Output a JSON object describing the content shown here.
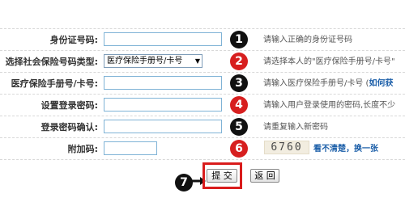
{
  "form": {
    "rows": [
      {
        "label": "身份证号码:",
        "value": "",
        "hint": "请输入正确的身份证号码",
        "badge": "1",
        "badge_color": "#111111"
      },
      {
        "label": "选择社会保险号码类型:",
        "selected": "医疗保险手册号/卡号",
        "hint": "请选择本人的\"医疗保险手册号/卡号\"",
        "badge": "2",
        "badge_color": "#d71f1f"
      },
      {
        "label": "医疗保险手册号/卡号:",
        "value": "",
        "hint": "请输入医疗保险手册号/卡号 (",
        "hint_link": "如何获",
        "badge": "3",
        "badge_color": "#111111"
      },
      {
        "label": "设置登录密码:",
        "value": "",
        "hint": "请输入用户登录使用的密码,长度不少",
        "badge": "4",
        "badge_color": "#d71f1f"
      },
      {
        "label": "登录密码确认:",
        "value": "",
        "hint": "请重复输入新密码",
        "badge": "5",
        "badge_color": "#111111"
      },
      {
        "label": "附加码:",
        "value": "",
        "captcha": "6760",
        "refresh_link": "看不清楚，换一张",
        "badge": "6",
        "badge_color": "#d71f1f"
      }
    ]
  },
  "buttons": {
    "submit_label": "提 交",
    "back_label": "返 回",
    "badge": "7",
    "badge_color": "#111111"
  },
  "colors": {
    "highlight": "#d91c1c",
    "link": "#1b5ea8",
    "input_border": "#7fb3d6"
  }
}
